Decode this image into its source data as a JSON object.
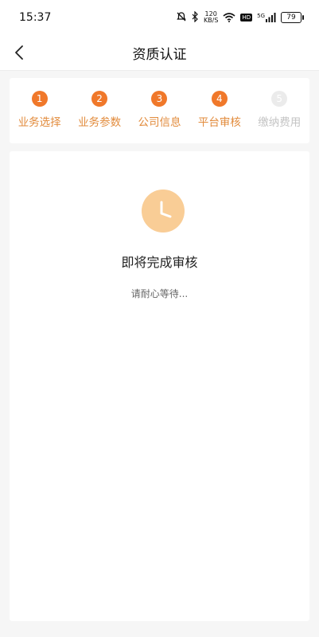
{
  "status_bar": {
    "time": "15:37",
    "speed_value": "120",
    "speed_unit": "KB/S",
    "network_label": "5G",
    "hd_badge": "HD",
    "battery_level": "79",
    "icons": [
      "mute-icon",
      "bluetooth-icon",
      "wifi-icon",
      "signal-icon",
      "battery-icon"
    ]
  },
  "nav": {
    "title": "资质认证",
    "back_icon": "chevron-left-icon"
  },
  "steps": [
    {
      "number": "1",
      "label": "业务选择",
      "state": "done"
    },
    {
      "number": "2",
      "label": "业务参数",
      "state": "done"
    },
    {
      "number": "3",
      "label": "公司信息",
      "state": "done"
    },
    {
      "number": "4",
      "label": "平台审核",
      "state": "current"
    },
    {
      "number": "5",
      "label": "缴纳费用",
      "state": "pending"
    }
  ],
  "review": {
    "icon": "clock-icon",
    "title": "即将完成审核",
    "subtitle": "请耐心等待..."
  },
  "colors": {
    "accent": "#f0782a",
    "step_label": "#e28b3c",
    "pending": "#ebebeb",
    "clock_bg": "#f9cd96"
  }
}
